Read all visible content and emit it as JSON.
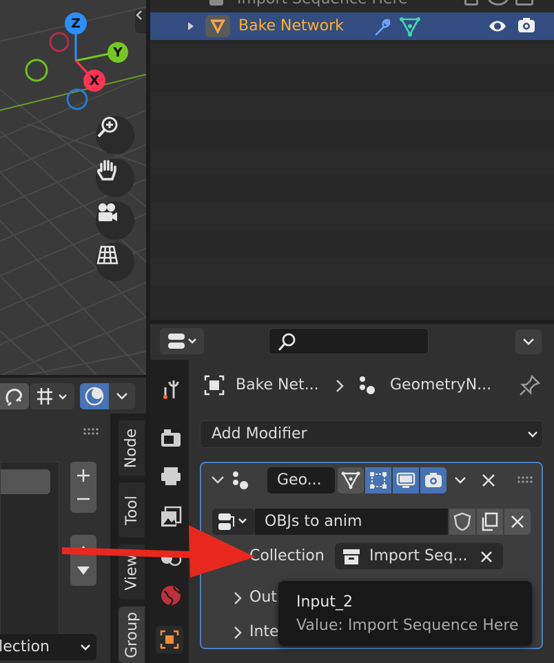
{
  "outliner": {
    "row_top_label": "Import Sequence Here",
    "row_selected_label": "Bake Network"
  },
  "properties": {
    "breadcrumb_object": "Bake Net...",
    "breadcrumb_modifier": "GeometryN...",
    "add_modifier_label": "Add Modifier",
    "modifier_name": "Geo...",
    "node_group_name": "OBJs to anim",
    "collection_label": "Collection",
    "collection_value": "Import Seq...",
    "output_label_partial": "Outp",
    "internal_label_partial": "Inte"
  },
  "tooltip": {
    "title": "Input_2",
    "value": "Value: Import Sequence Here"
  },
  "node_editor": {
    "tabs": [
      "Node",
      "Tool",
      "View",
      "Group"
    ],
    "dropdown_partial": "llection"
  },
  "viewport": {
    "axis_z": "Z",
    "axis_y": "Y",
    "axis_x": "X"
  },
  "colors": {
    "selected_row": "#334d80",
    "selected_text": "#ffaf29",
    "accent_blue": "#4772b3",
    "arrow_red": "#e8281e"
  }
}
